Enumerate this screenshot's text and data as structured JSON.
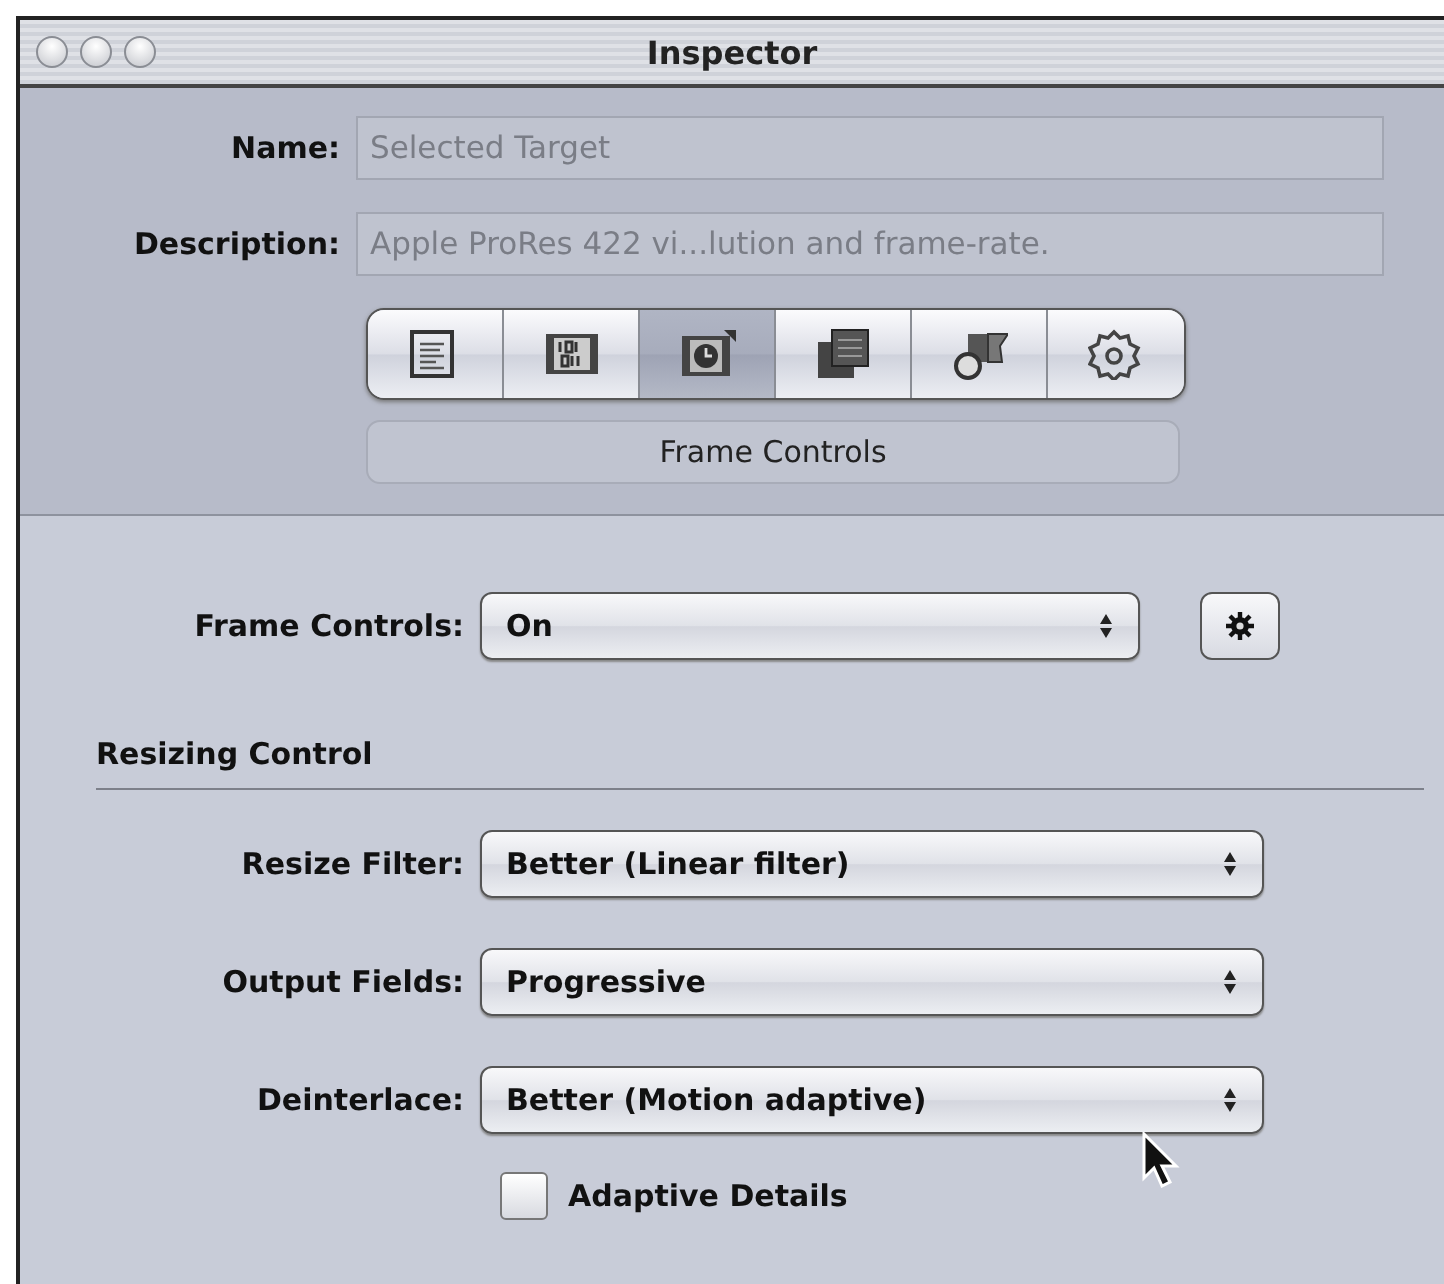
{
  "window": {
    "title": "Inspector"
  },
  "fields": [
    {
      "label": "Name:",
      "value": "Selected Target",
      "disabled": true
    },
    {
      "label": "Description:",
      "value": "Apple ProRes 422 vi...lution and frame-rate.",
      "disabled": true
    }
  ],
  "tabs": [
    {
      "selected": false
    },
    {
      "selected": false
    },
    {
      "selected": true
    },
    {
      "selected": false
    },
    {
      "selected": false
    },
    {
      "selected": false
    }
  ],
  "panel_title": "Frame Controls",
  "frame_controls": {
    "label": "Frame Controls:",
    "value": "On"
  },
  "section": {
    "title": "Resizing Control"
  },
  "popups": [
    {
      "label": "Resize Filter:",
      "value": "Better (Linear filter)"
    },
    {
      "label": "Output Fields:",
      "value": "Progressive"
    },
    {
      "label": "Deinterlace:",
      "value": "Better (Motion adaptive)"
    }
  ],
  "checkbox": {
    "label": "Adaptive Details",
    "checked": false
  }
}
